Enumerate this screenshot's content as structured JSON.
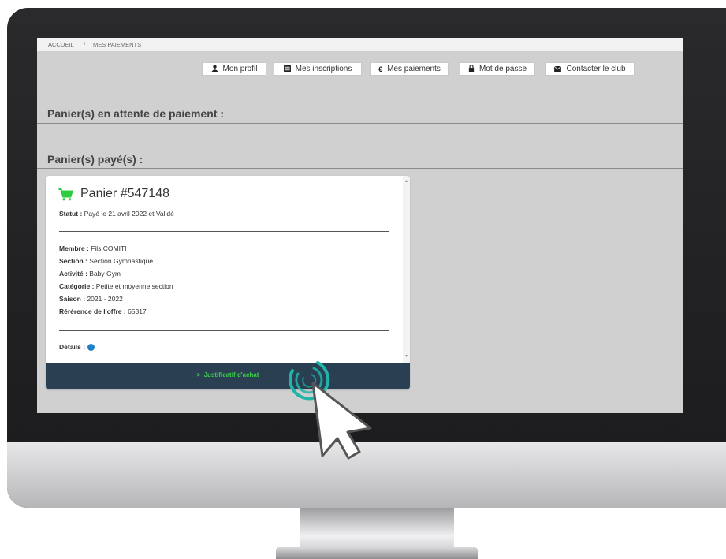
{
  "breadcrumb": {
    "home": "ACCUEIL",
    "separator": "/",
    "current": "MES PAIEMENTS"
  },
  "nav": [
    {
      "label": "Mon profil",
      "icon": "user-icon"
    },
    {
      "label": "Mes inscriptions",
      "icon": "list-icon"
    },
    {
      "label": "Mes paiements",
      "icon": "euro-icon"
    },
    {
      "label": "Mot de passe",
      "icon": "lock-icon"
    },
    {
      "label": "Contacter le club",
      "icon": "envelope-icon"
    }
  ],
  "sections": {
    "pending": "Panier(s) en attente de paiement :",
    "paid": "Panier(s) payé(s) :"
  },
  "cart": {
    "title": "Panier #547148",
    "statut_label": "Statut :",
    "statut_value": "Payé le 21 avril 2022 et Validé",
    "fields": [
      {
        "label": "Membre :",
        "value": "Fils COMITI"
      },
      {
        "label": "Section :",
        "value": "Section Gymnastique"
      },
      {
        "label": "Activité :",
        "value": "Baby Gym"
      },
      {
        "label": "Catégorie :",
        "value": "Petite et moyenne section"
      },
      {
        "label": "Saison :",
        "value": "2021 - 2022"
      },
      {
        "label": "Rérérence de l'offre :",
        "value": "65317"
      }
    ],
    "details_label": "Détails :",
    "footer_link": "Justificatif d'achat"
  },
  "colors": {
    "cart_icon": "#2ecc40",
    "footer_bg": "#2a3f52",
    "footer_link": "#3ccc4a",
    "info_icon": "#1e7fc8",
    "click_ring": "#1fb5a8"
  }
}
